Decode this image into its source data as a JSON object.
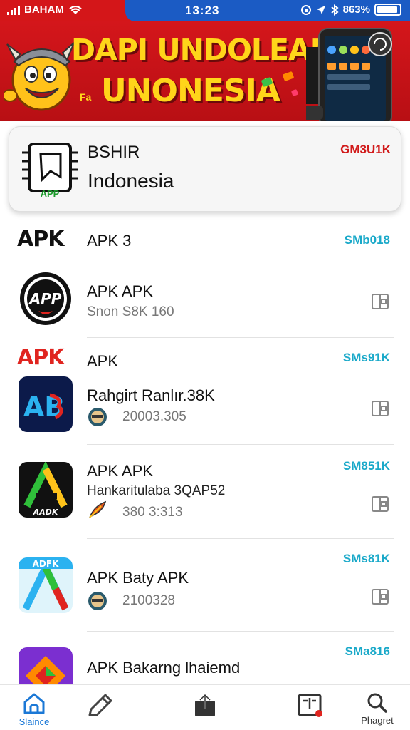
{
  "status_bar": {
    "carrier": "BAHAM",
    "time": "13:23",
    "battery": "863%"
  },
  "banner": {
    "line1": "DAPI UNDOLEAN",
    "line2": "UNONESIA",
    "prefix": "Fa",
    "mascot_icon": "viking-mascot-icon",
    "phone_icon": "phone-mockup-icon"
  },
  "featured": {
    "title": "BSHIR",
    "subtitle": "Indonesia",
    "size": "GM3U1K",
    "icon_label": "APP"
  },
  "list": [
    {
      "icon_text": "APK",
      "title": "APK 3",
      "subtitle": "",
      "size": "SMb018"
    },
    {
      "icon_text": "APP",
      "title": "APK  APK",
      "subtitle": "Snon  S8K 160",
      "size": ""
    },
    {
      "icon_text": "APK",
      "title": "APK",
      "subtitle": "",
      "size": "SMs91K"
    },
    {
      "icon_text": "AB",
      "title": "Rahgirt  Ranlır.38K",
      "subtitle": "20003.305",
      "size": ""
    },
    {
      "icon_text": "AADK",
      "title": "APK APK",
      "subtitle": "Hankaritulaba 3QAP52",
      "meta": "380 3:313",
      "size": "SM851K"
    },
    {
      "icon_text": "ADFK",
      "title": "APK Baty APK",
      "subtitle": "2100328",
      "size": "SMs81K"
    },
    {
      "icon_text": "",
      "title": "APK  Bakarng lhaiemd",
      "subtitle": "",
      "size": "SMa816"
    }
  ],
  "bottom_nav": [
    {
      "label": "Slaince",
      "icon": "home-icon"
    },
    {
      "label": "",
      "icon": "pencil-icon"
    },
    {
      "label": "",
      "icon": "share-upload-icon"
    },
    {
      "label": "",
      "icon": "inbox-icon"
    },
    {
      "label": "Phagret",
      "icon": "search-icon"
    }
  ],
  "colors": {
    "banner_red": "#d4161b",
    "banner_yellow": "#ffd51a",
    "status_blue": "#1b5bc4",
    "size_teal": "#1aa9c9",
    "size_red": "#d11a1a",
    "nav_active": "#1b78d6"
  }
}
